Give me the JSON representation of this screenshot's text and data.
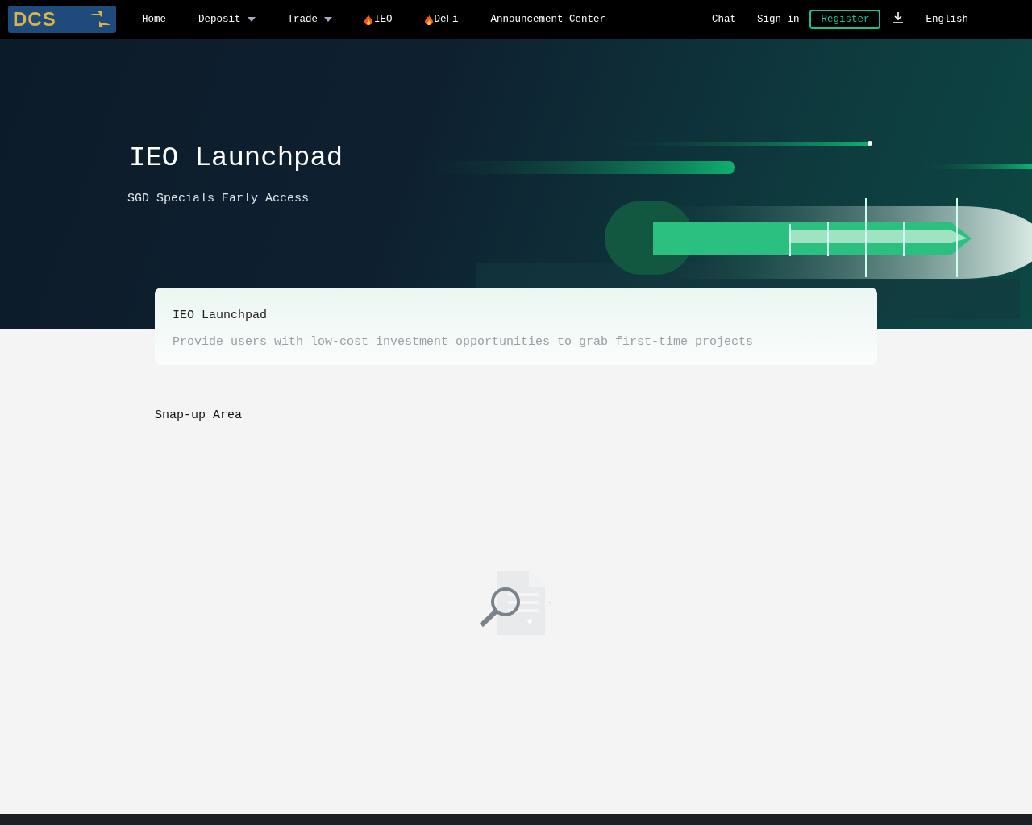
{
  "logo": {
    "text": "DCS"
  },
  "nav": {
    "items": [
      {
        "label": "Home",
        "kind": "plain"
      },
      {
        "label": "Deposit",
        "kind": "dropdown"
      },
      {
        "label": "Trade",
        "kind": "dropdown"
      },
      {
        "label": "IEO",
        "kind": "hot"
      },
      {
        "label": "DeFi",
        "kind": "hot"
      },
      {
        "label": "Announcement Center",
        "kind": "plain"
      }
    ],
    "right": [
      {
        "label": "Chat",
        "kind": "link"
      },
      {
        "label": "Sign in",
        "kind": "link"
      },
      {
        "label": "Register",
        "kind": "outlined"
      },
      {
        "kind": "download"
      },
      {
        "label": "English",
        "kind": "link"
      }
    ]
  },
  "hero": {
    "title": "IEO Launchpad",
    "subtitle": "SGD Specials Early Access"
  },
  "intro_card": {
    "title": "IEO Launchpad",
    "text": "Provide users with low-cost investment opportunities to grab first-time projects"
  },
  "section": {
    "title": "Snap-up Area"
  }
}
